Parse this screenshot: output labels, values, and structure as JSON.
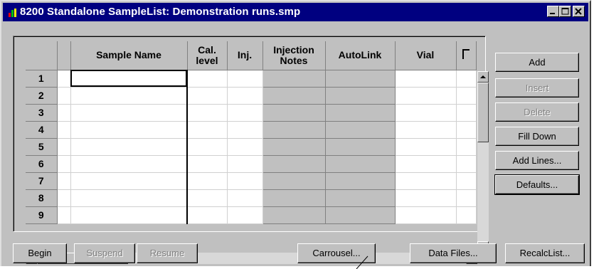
{
  "window": {
    "title": "8200 Standalone SampleList: Demonstration runs.smp"
  },
  "grid": {
    "columns": [
      "Sample Name",
      "Cal.\nlevel",
      "Inj.",
      "Injection\nNotes",
      "AutoLink",
      "Vial"
    ],
    "rows": [
      "1",
      "2",
      "3",
      "4",
      "5",
      "6",
      "7",
      "8",
      "9"
    ]
  },
  "side_buttons": {
    "add": "Add",
    "insert": "Insert",
    "delete": "Delete",
    "fill_down": "Fill Down",
    "add_lines": "Add Lines...",
    "defaults": "Defaults..."
  },
  "bottom_buttons": {
    "begin": "Begin",
    "suspend": "Suspend",
    "resume": "Resume",
    "carrousel": "Carrousel...",
    "data_files": "Data Files...",
    "recalc_list": "RecalcList..."
  },
  "icons": {
    "app": "app-colored-icon",
    "minimize": "minimize-icon",
    "maximize": "maximize-icon",
    "close": "close-icon",
    "scroll_up": "arrow-up-icon",
    "scroll_down": "arrow-down-icon",
    "scroll_left": "arrow-left-icon",
    "scroll_right": "arrow-right-icon"
  },
  "colors": {
    "titlebar": "#000080",
    "face": "#c0c0c0"
  }
}
